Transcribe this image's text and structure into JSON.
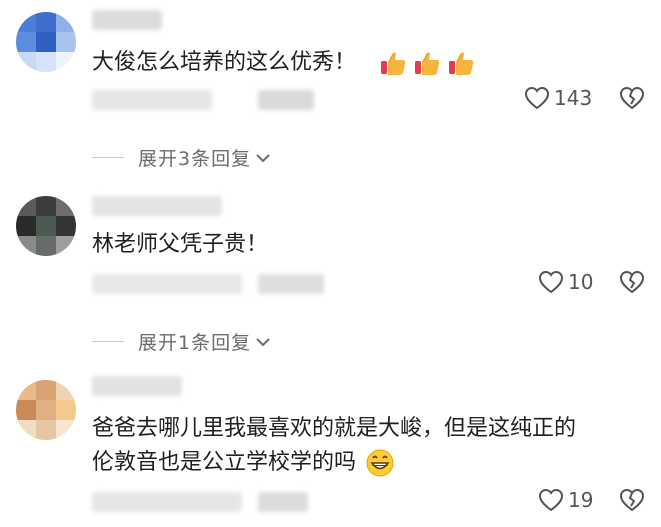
{
  "comments": [
    {
      "text": "大俊怎么培养的这么优秀！",
      "likes": "143",
      "emoji": "thumbs-up-icon",
      "emoji_count": 3,
      "replies": "展开3条回复"
    },
    {
      "text": "林老师父凭子贵！",
      "likes": "10",
      "replies": "展开1条回复"
    },
    {
      "text_line1": "爸爸去哪儿里我最喜欢的就是大峻，但是这纯正的",
      "text_line2": "伦敦音也是公立学校学的吗",
      "emoji": "grinning-face-icon",
      "likes": "19"
    }
  ],
  "colors": {
    "text": "#1f1f1f",
    "meta": "#6b6b6b",
    "icon": "#555555"
  }
}
